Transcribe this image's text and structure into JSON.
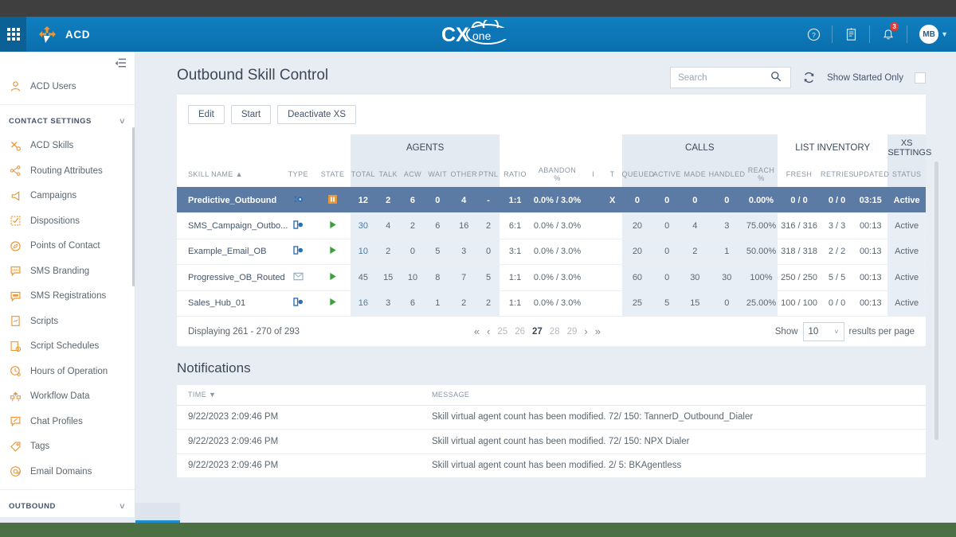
{
  "navbar": {
    "app_name": "ACD",
    "product_logo": "CXone",
    "icons": [
      "apps-grid-icon",
      "help-circle-icon",
      "feedback-icon",
      "bell-icon"
    ],
    "notification_count": "3",
    "avatar_initials": "MB"
  },
  "sidebar": {
    "collapse_label": "collapse-menu",
    "items": [
      {
        "label": "ACD Users",
        "icon": "user-icon",
        "type": "item"
      },
      {
        "label": "CONTACT SETTINGS",
        "icon": "chevron-down-icon",
        "type": "group"
      },
      {
        "label": "ACD Skills",
        "icon": "skills-icon",
        "type": "item"
      },
      {
        "label": "Routing Attributes",
        "icon": "routing-icon",
        "type": "item"
      },
      {
        "label": "Campaigns",
        "icon": "megaphone-icon",
        "type": "item"
      },
      {
        "label": "Dispositions",
        "icon": "checklist-icon",
        "type": "item"
      },
      {
        "label": "Points of Contact",
        "icon": "compass-icon",
        "type": "item"
      },
      {
        "label": "SMS Branding",
        "icon": "sms-icon",
        "type": "item"
      },
      {
        "label": "SMS Registrations",
        "icon": "sms-register-icon",
        "type": "item"
      },
      {
        "label": "Scripts",
        "icon": "script-icon",
        "type": "item"
      },
      {
        "label": "Script Schedules",
        "icon": "script-schedule-icon",
        "type": "item"
      },
      {
        "label": "Hours of Operation",
        "icon": "clock-icon",
        "type": "item"
      },
      {
        "label": "Workflow Data",
        "icon": "workflow-icon",
        "type": "item"
      },
      {
        "label": "Chat Profiles",
        "icon": "chat-icon",
        "type": "item"
      },
      {
        "label": "Tags",
        "icon": "tag-icon",
        "type": "item"
      },
      {
        "label": "Email Domains",
        "icon": "at-icon",
        "type": "item"
      },
      {
        "label": "OUTBOUND",
        "icon": "chevron-down-icon",
        "type": "group"
      }
    ]
  },
  "page": {
    "title": "Outbound Skill Control",
    "buttons": [
      "Edit",
      "Start",
      "Deactivate XS"
    ],
    "search": {
      "placeholder": "Search",
      "value": ""
    },
    "refresh_icon": "refresh-icon",
    "show_started_only_label": "Show Started Only",
    "show_started_only_checked": false
  },
  "table": {
    "group_headers": [
      {
        "label": "",
        "span": 3,
        "shaded": false
      },
      {
        "label": "AGENTS",
        "span": 6,
        "shaded": true
      },
      {
        "label": "",
        "span": 4,
        "shaded": false
      },
      {
        "label": "CALLS",
        "span": 5,
        "shaded": true
      },
      {
        "label": "LIST INVENTORY",
        "span": 3,
        "shaded": false
      },
      {
        "label": "XS SETTINGS",
        "span": 1,
        "shaded": true
      }
    ],
    "columns": [
      {
        "label": "SKILL NAME",
        "sort": "▲",
        "align": "left",
        "shaded": false
      },
      {
        "label": "TYPE",
        "shaded": false
      },
      {
        "label": "STATE",
        "shaded": false
      },
      {
        "label": "TOTAL",
        "shaded": true
      },
      {
        "label": "TALK",
        "shaded": true
      },
      {
        "label": "ACW",
        "shaded": true
      },
      {
        "label": "WAIT",
        "shaded": true
      },
      {
        "label": "OTHER",
        "shaded": true
      },
      {
        "label": "PTNL",
        "shaded": true
      },
      {
        "label": "RATIO",
        "shaded": false
      },
      {
        "label": "ABANDON %",
        "shaded": false
      },
      {
        "label": "I",
        "shaded": false
      },
      {
        "label": "T",
        "shaded": false
      },
      {
        "label": "QUEUED",
        "shaded": true
      },
      {
        "label": "ACTIVE",
        "shaded": true
      },
      {
        "label": "MADE",
        "shaded": true
      },
      {
        "label": "HANDLED",
        "shaded": true
      },
      {
        "label": "REACH %",
        "shaded": true
      },
      {
        "label": "FRESH",
        "shaded": false
      },
      {
        "label": "RETRIES",
        "shaded": false
      },
      {
        "label": "UPDATED",
        "shaded": false
      },
      {
        "label": "STATUS",
        "shaded": true
      }
    ],
    "rows": [
      {
        "selected": true,
        "skill_name": "Predictive_Outbound",
        "type_icon": "predictive-dialer-icon",
        "state_icon": "paused-icon",
        "total": "12",
        "talk": "2",
        "acw": "6",
        "wait": "0",
        "other": "4",
        "ptnl": "-",
        "ratio": "1:1",
        "abandon": "0.0% / 3.0%",
        "i": "",
        "t": "X",
        "queued": "0",
        "active": "0",
        "made": "0",
        "handled": "0",
        "reach": "0.00%",
        "fresh": "0 / 0",
        "retries": "0 / 0",
        "updated": "03:15",
        "status": "Active"
      },
      {
        "selected": false,
        "skill_name": "SMS_Campaign_Outbo...",
        "type_icon": "outbound-icon",
        "state_icon": "started-icon",
        "total": "30",
        "talk": "4",
        "acw": "2",
        "wait": "6",
        "other": "16",
        "ptnl": "2",
        "ratio": "6:1",
        "abandon": "0.0% / 3.0%",
        "i": "",
        "t": "",
        "queued": "20",
        "active": "0",
        "made": "4",
        "handled": "3",
        "reach": "75.00%",
        "fresh": "316 / 316",
        "retries": "3 / 3",
        "updated": "00:13",
        "status": "Active"
      },
      {
        "selected": false,
        "skill_name": "Example_Email_OB",
        "type_icon": "outbound-icon",
        "state_icon": "started-icon",
        "total": "10",
        "talk": "2",
        "acw": "0",
        "wait": "5",
        "other": "3",
        "ptnl": "0",
        "ratio": "3:1",
        "abandon": "0.0% / 3.0%",
        "i": "",
        "t": "",
        "queued": "20",
        "active": "0",
        "made": "2",
        "handled": "1",
        "reach": "50.00%",
        "fresh": "318 / 318",
        "retries": "2 / 2",
        "updated": "00:13",
        "status": "Active"
      },
      {
        "selected": false,
        "skill_name": "Progressive_OB_Routed",
        "type_icon": "email-outbound-icon",
        "state_icon": "started-icon",
        "total": "45",
        "talk": "15",
        "acw": "10",
        "wait": "8",
        "other": "7",
        "ptnl": "5",
        "ratio": "1:1",
        "abandon": "0.0% / 3.0%",
        "i": "",
        "t": "",
        "queued": "60",
        "active": "0",
        "made": "30",
        "handled": "30",
        "reach": "100%",
        "fresh": "250 / 250",
        "retries": "5 / 5",
        "updated": "00:13",
        "status": "Active"
      },
      {
        "selected": false,
        "skill_name": "Sales_Hub_01",
        "type_icon": "outbound-icon",
        "state_icon": "started-icon",
        "total": "16",
        "talk": "3",
        "acw": "6",
        "wait": "1",
        "other": "2",
        "ptnl": "2",
        "ratio": "1:1",
        "abandon": "0.0% / 3.0%",
        "i": "",
        "t": "",
        "queued": "25",
        "active": "5",
        "made": "15",
        "handled": "0",
        "reach": "25.00%",
        "fresh": "100 / 100",
        "retries": "0 / 0",
        "updated": "00:13",
        "status": "Active"
      }
    ]
  },
  "pagination": {
    "displaying": "Displaying 261 - 270 of 293",
    "first_icon": "«",
    "prev_icon": "‹",
    "pages": [
      "25",
      "26",
      "27",
      "28",
      "29"
    ],
    "current_page": "27",
    "next_icon": "›",
    "last_icon": "»",
    "show_label": "Show",
    "page_size": "10",
    "results_label": "results per page"
  },
  "notifications": {
    "title": "Notifications",
    "columns": [
      "TIME",
      "MESSAGE"
    ],
    "sort_icon": "▼",
    "rows": [
      {
        "time": "9/22/2023 2:09:46 PM",
        "message": "Skill virtual agent count has been modified. 72/ 150: TannerD_Outbound_Dialer"
      },
      {
        "time": "9/22/2023 2:09:46 PM",
        "message": "Skill virtual agent count has been modified. 72/ 150: NPX Dialer"
      },
      {
        "time": "9/22/2023 2:09:46 PM",
        "message": "Skill virtual agent count has been modified. 2/ 5: BKAgentless"
      }
    ]
  },
  "colors": {
    "brand_blue": "#0f7fc0",
    "accent_orange": "#e8973a",
    "selected_row": "#5b7ba5",
    "badge_red": "#e03b33",
    "page_bg": "#e8edf4",
    "bottom_strip": "#4a7043"
  }
}
